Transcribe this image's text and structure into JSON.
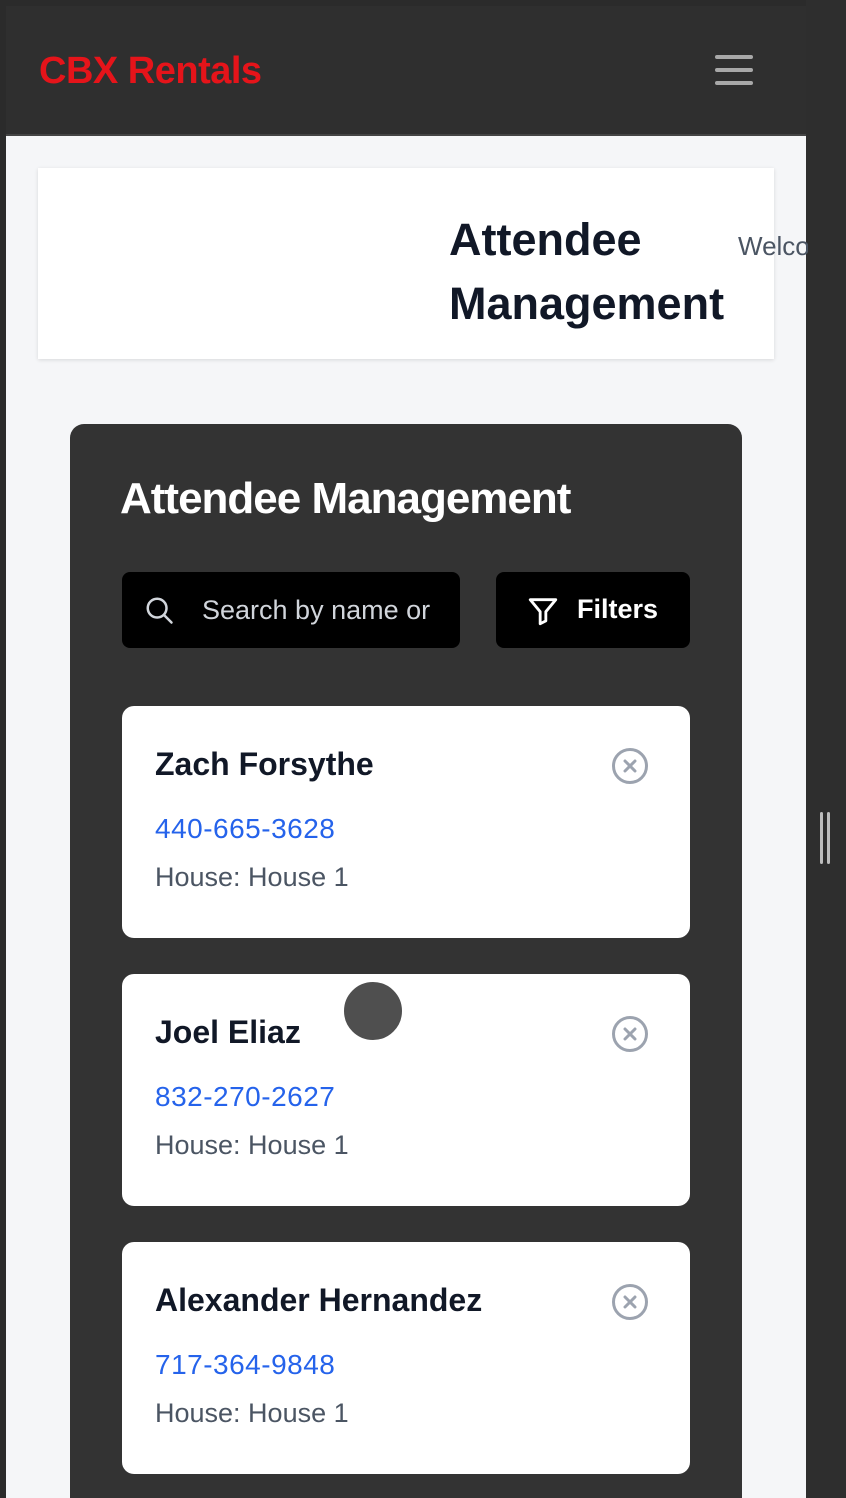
{
  "navbar": {
    "brand": "CBX Rentals"
  },
  "header": {
    "title": "Attendee Management",
    "welcome_text": "Welcome, cbxa"
  },
  "panel": {
    "title": "Attendee Management",
    "search": {
      "placeholder": "Search by name or phone",
      "value": ""
    },
    "filters_label": "Filters"
  },
  "attendees": [
    {
      "name": "Zach Forsythe",
      "phone": "440-665-3628",
      "house": "House: House 1"
    },
    {
      "name": "Joel Eliaz",
      "phone": "832-270-2627",
      "house": "House: House 1"
    },
    {
      "name": "Alexander Hernandez",
      "phone": "717-364-9848",
      "house": "House: House 1"
    }
  ],
  "colors": {
    "brand": "#e5141a",
    "link": "#2563eb",
    "panel": "#333333"
  },
  "icons": {
    "menu": "hamburger-menu-icon",
    "search": "search-icon",
    "filter": "filter-funnel-icon",
    "remove": "close-circle-icon"
  }
}
